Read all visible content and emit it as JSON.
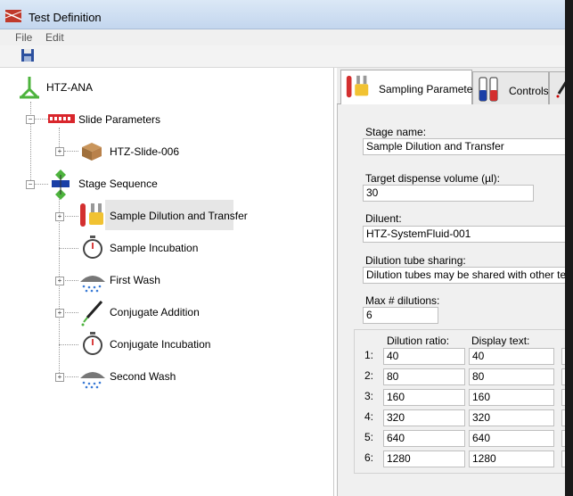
{
  "window": {
    "title": "Test Definition"
  },
  "menu": [
    "File",
    "Edit"
  ],
  "tree": {
    "root": "HTZ-ANA",
    "slide_parameters": "Slide Parameters",
    "slide": "HTZ-Slide-006",
    "stage_sequence": "Stage Sequence",
    "stages": [
      "Sample Dilution and Transfer",
      "Sample Incubation",
      "First Wash",
      "Conjugate Addition",
      "Conjugate Incubation",
      "Second Wash"
    ]
  },
  "tabs": [
    "Sampling Parameters",
    "Controls"
  ],
  "form": {
    "stage_name_label": "Stage name:",
    "stage_name": "Sample Dilution and Transfer",
    "target_volume_label": "Target dispense volume (µl):",
    "target_volume": "30",
    "diluent_label": "Diluent:",
    "diluent": "HTZ-SystemFluid-001",
    "tube_sharing_label": "Dilution tube sharing:",
    "tube_sharing": "Dilution tubes may be shared with other tests",
    "max_dilutions_label": "Max # dilutions:",
    "max_dilutions": "6",
    "col_ratio": "Dilution ratio:",
    "col_display": "Display text:",
    "dilutions": [
      {
        "n": "1:",
        "ratio": "40",
        "display": "40"
      },
      {
        "n": "2:",
        "ratio": "80",
        "display": "80"
      },
      {
        "n": "3:",
        "ratio": "160",
        "display": "160"
      },
      {
        "n": "4:",
        "ratio": "320",
        "display": "320"
      },
      {
        "n": "5:",
        "ratio": "640",
        "display": "640"
      },
      {
        "n": "6:",
        "ratio": "1280",
        "display": "1280"
      }
    ]
  },
  "icons": {
    "app": "test-definition-icon",
    "save": "floppy-disk-icon",
    "root": "antibody-icon",
    "slide_parameters": "slide-icon",
    "slide": "cardboard-box-icon",
    "stage_sequence": "flowchart-icon",
    "dilution": "test-tubes-icon",
    "incubation": "stopwatch-icon",
    "wash": "shower-head-icon",
    "conjugate": "pipette-icon"
  },
  "colors": {
    "root_icon": "#4db33d",
    "slide_icon": "#d9262c",
    "flow_icon": "#1a3fa6"
  }
}
